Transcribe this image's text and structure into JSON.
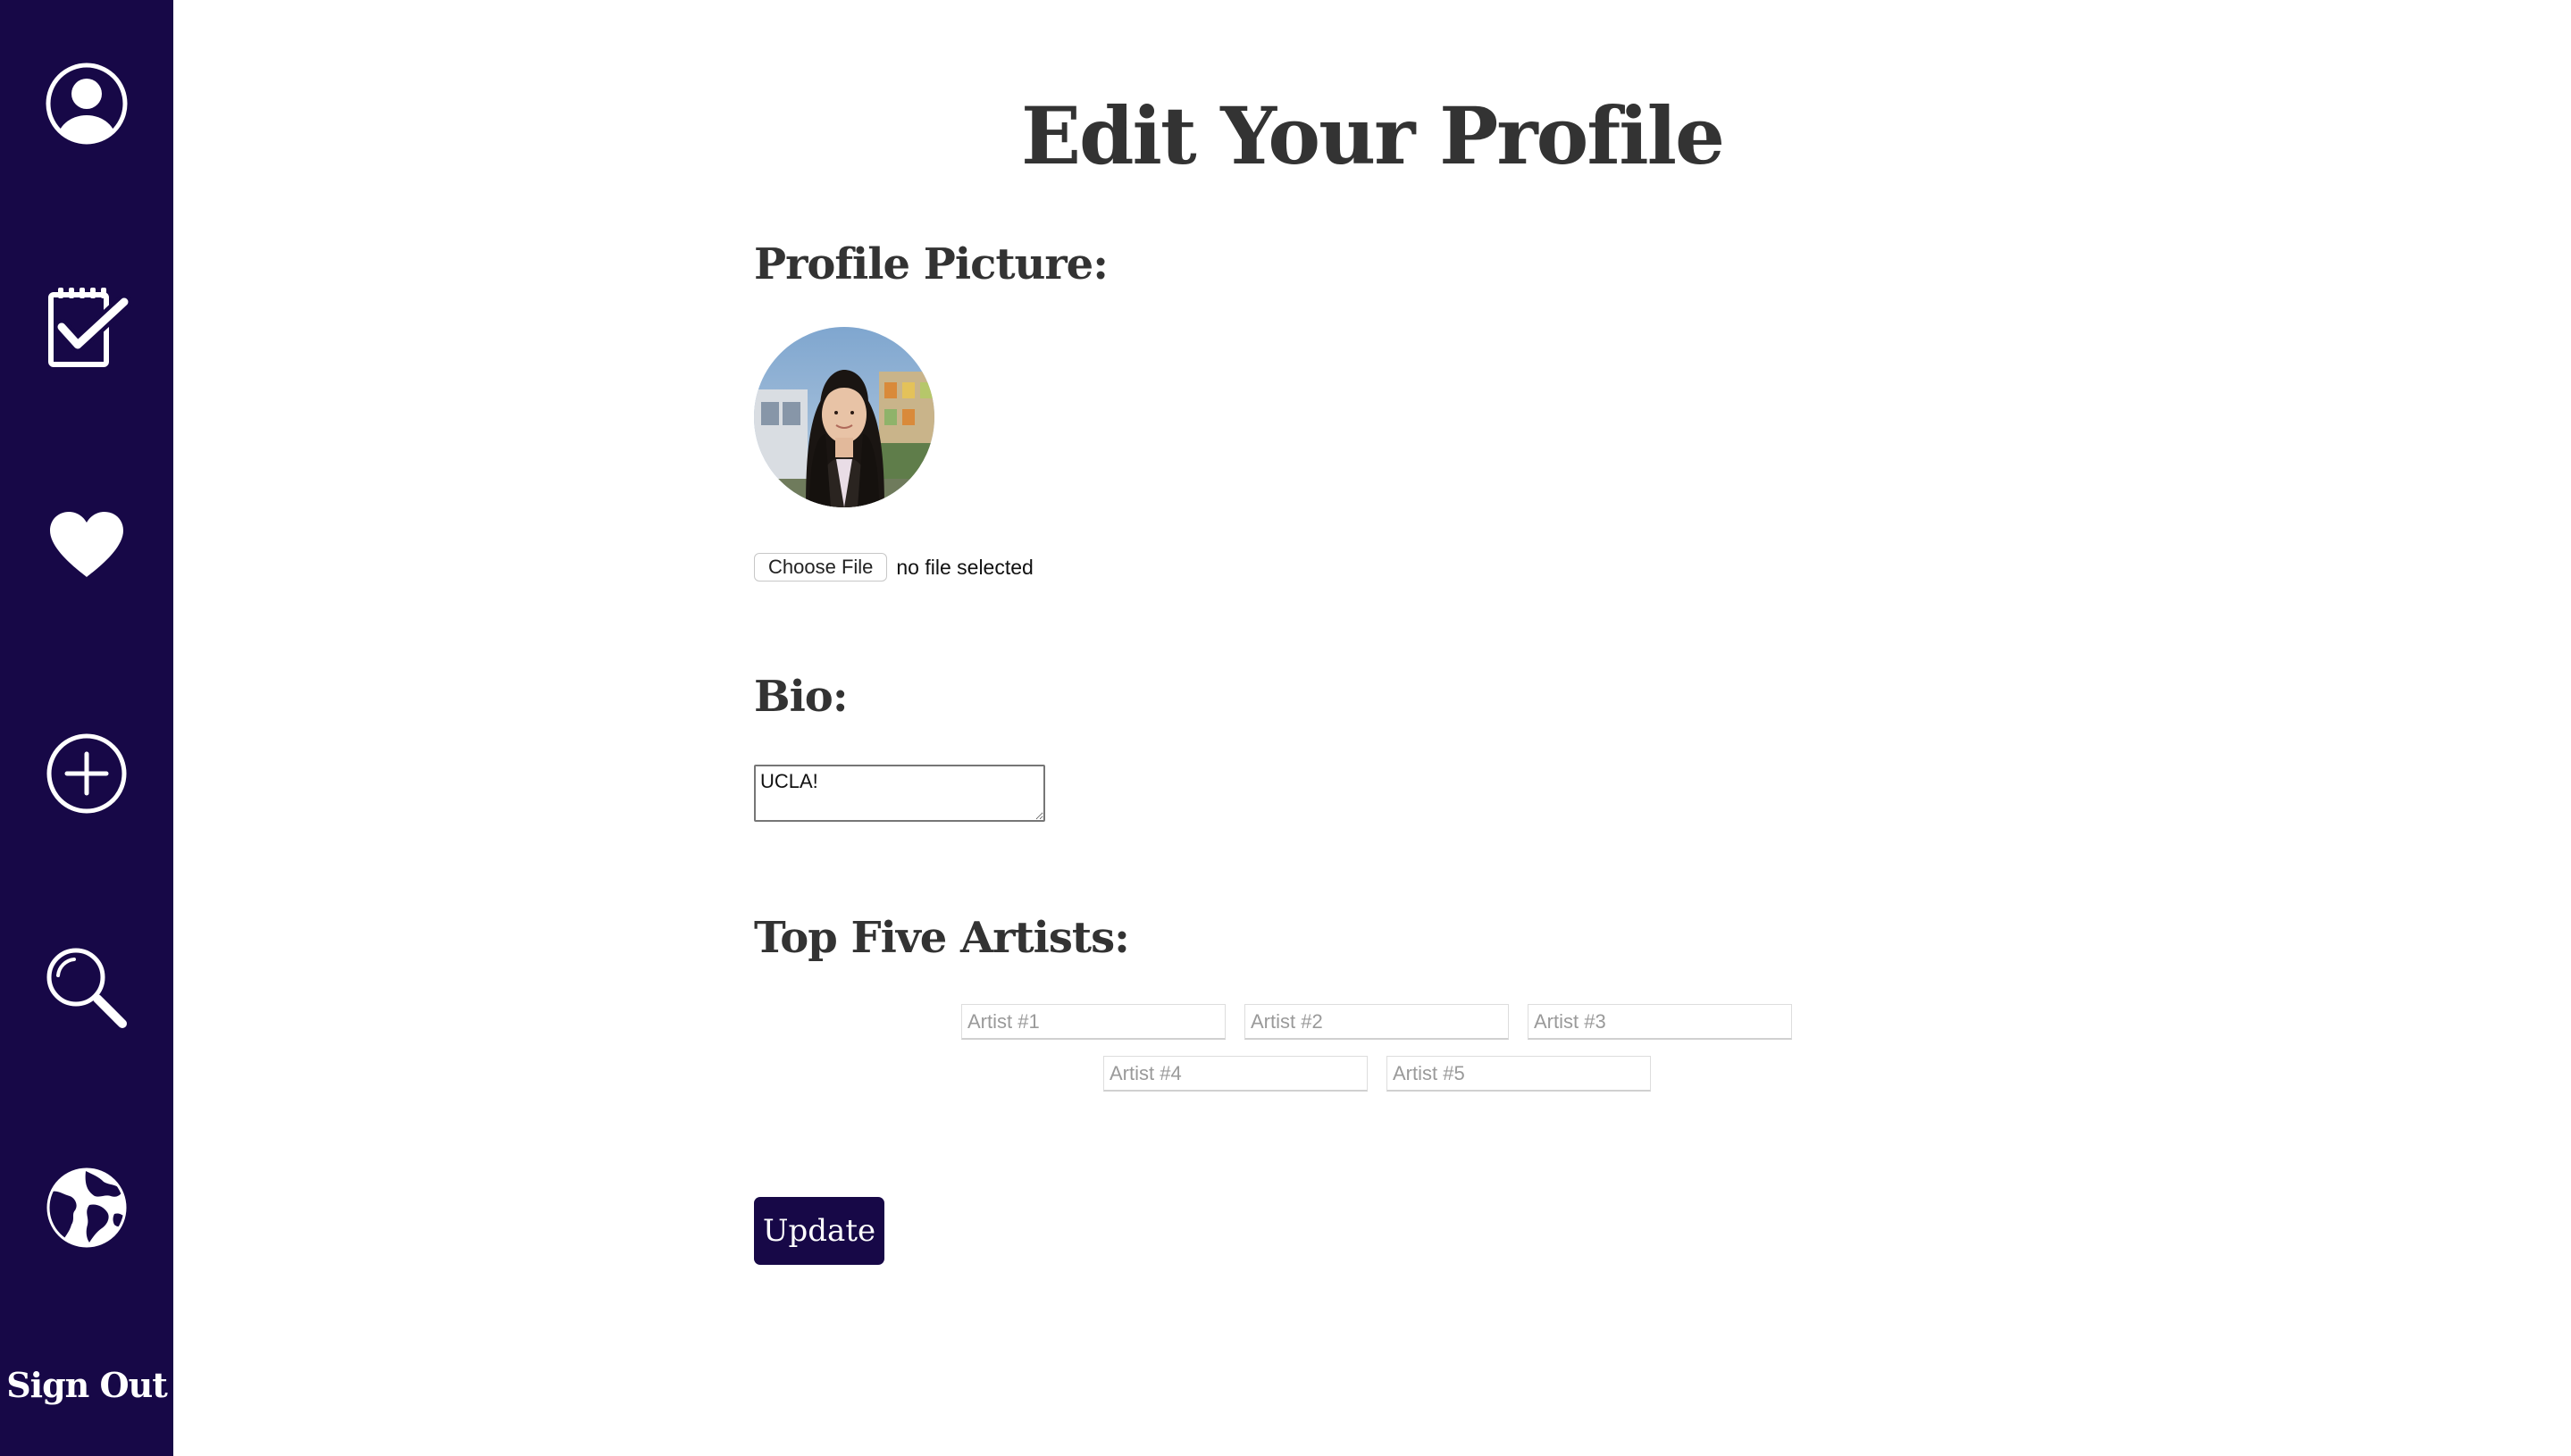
{
  "sidebar": {
    "items": [
      {
        "icon": "profile-icon"
      },
      {
        "icon": "checklist-icon"
      },
      {
        "icon": "heart-icon"
      },
      {
        "icon": "plus-circle-icon"
      },
      {
        "icon": "search-icon"
      },
      {
        "icon": "globe-icon"
      }
    ],
    "sign_out_label": "Sign Out",
    "background_color": "#170847",
    "icon_color": "#ffffff"
  },
  "main": {
    "title": "Edit Your Profile",
    "profile_picture": {
      "heading": "Profile Picture:",
      "choose_file_label": "Choose File",
      "file_status": "no file selected"
    },
    "bio": {
      "heading": "Bio:",
      "value": "UCLA!"
    },
    "top_artists": {
      "heading": "Top Five Artists:",
      "fields": [
        {
          "placeholder": "Artist #1",
          "value": ""
        },
        {
          "placeholder": "Artist #2",
          "value": ""
        },
        {
          "placeholder": "Artist #3",
          "value": ""
        },
        {
          "placeholder": "Artist #4",
          "value": ""
        },
        {
          "placeholder": "Artist #5",
          "value": ""
        }
      ]
    },
    "update_label": "Update",
    "accent_color": "#170847",
    "heading_color": "#333333"
  }
}
